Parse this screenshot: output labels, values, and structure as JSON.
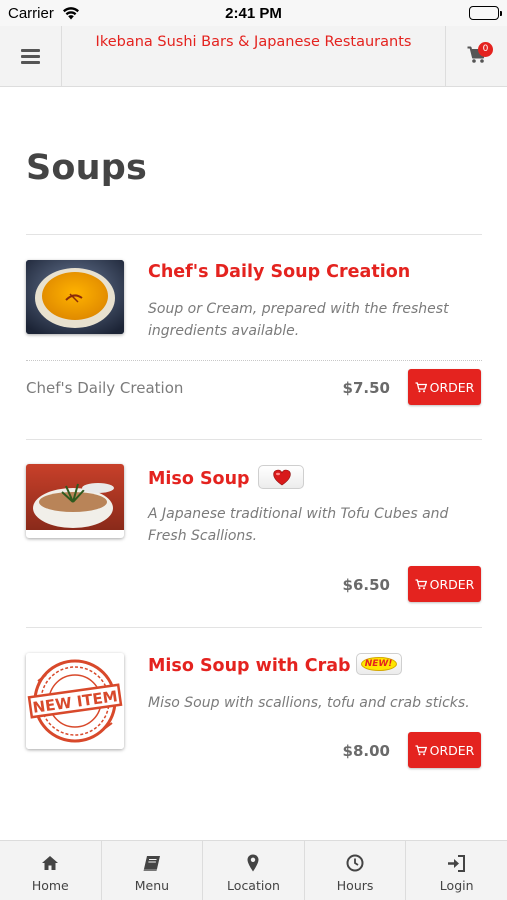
{
  "status_bar": {
    "carrier": "Carrier",
    "time": "2:41 PM"
  },
  "header": {
    "title": "Ikebana Sushi Bars & Japanese Restaurants",
    "cart_count": "0",
    "brand_color": "#e4231f"
  },
  "page": {
    "title": "Soups"
  },
  "items": [
    {
      "name": "Chef's Daily Soup Creation",
      "description": "Soup or Cream, prepared with the freshest ingredients available.",
      "variant": "Chef's Daily Creation",
      "price": "$7.50",
      "order_label": "ORDER"
    },
    {
      "name": "Miso Soup",
      "badge_icon": "heart-icon",
      "description": "A Japanese traditional with Tofu Cubes and Fresh Scallions.",
      "price": "$6.50",
      "order_label": "ORDER"
    },
    {
      "name": "Miso Soup with Crab",
      "badge_text": "NEW!",
      "stamp_text": "NEW ITEM",
      "description": "Miso Soup with scallions, tofu and crab sticks.",
      "price": "$8.00",
      "order_label": "ORDER"
    }
  ],
  "tabbar": [
    {
      "label": "Home",
      "icon": "home-icon"
    },
    {
      "label": "Menu",
      "icon": "menu-book-icon"
    },
    {
      "label": "Location",
      "icon": "location-pin-icon"
    },
    {
      "label": "Hours",
      "icon": "clock-icon"
    },
    {
      "label": "Login",
      "icon": "login-icon"
    }
  ]
}
